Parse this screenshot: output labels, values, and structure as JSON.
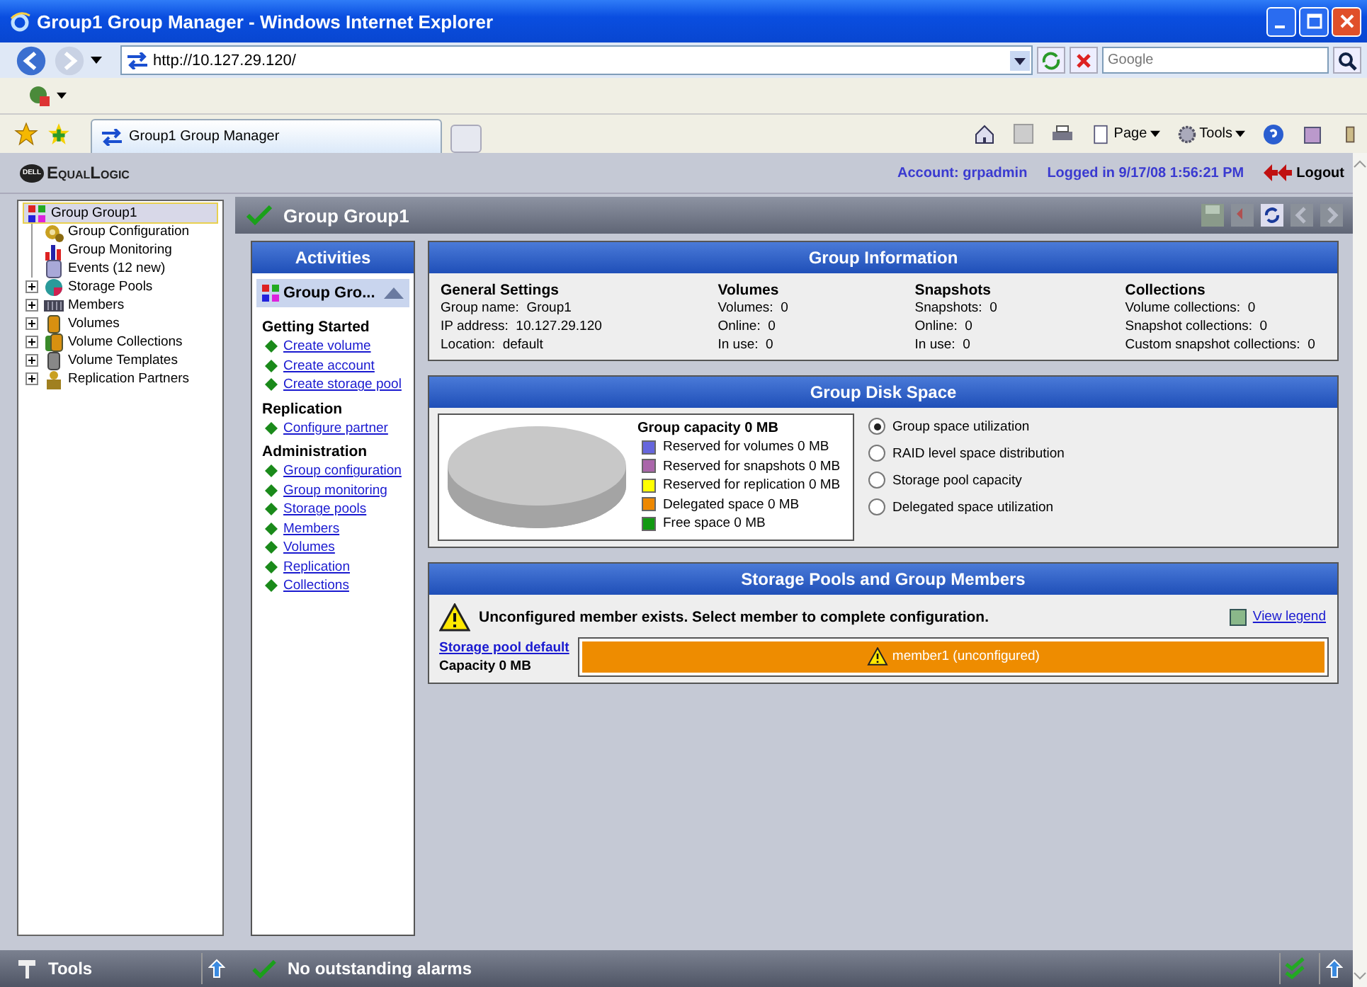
{
  "window": {
    "title": "Group1 Group Manager - Windows Internet Explorer"
  },
  "browser": {
    "address": "http://10.127.29.120/",
    "search_placeholder": "Google",
    "tab": "Group1 Group Manager",
    "commands": [
      "Page",
      "Tools"
    ]
  },
  "app_header": {
    "logo_badge": "DELL",
    "logo": "EqualLogic",
    "account": "Account: grpadmin",
    "logged_in": "Logged in 9/17/08 1:56:21 PM",
    "logout": "Logout"
  },
  "tree": [
    {
      "label": "Group Group1",
      "kind": "group",
      "selected": true,
      "children": [
        {
          "label": "Group Configuration",
          "kind": "config",
          "selected": false
        },
        {
          "label": "Group Monitoring",
          "kind": "monitor",
          "selected": false
        },
        {
          "label": "Events (12 new)",
          "kind": "events",
          "selected": false
        },
        {
          "label": "Storage Pools",
          "kind": "pools",
          "selected": false,
          "expanded": false
        },
        {
          "label": "Members",
          "kind": "members",
          "selected": false,
          "expanded": false
        },
        {
          "label": "Volumes",
          "kind": "volume",
          "selected": false,
          "expanded": false
        },
        {
          "label": "Volume Collections",
          "kind": "collections",
          "selected": false,
          "expanded": false
        },
        {
          "label": "Volume Templates",
          "kind": "template",
          "selected": false,
          "expanded": false
        },
        {
          "label": "Replication Partners",
          "kind": "partners",
          "selected": false,
          "expanded": false
        }
      ]
    }
  ],
  "main_header": {
    "title": "Group Group1"
  },
  "activities": {
    "title": "Activities",
    "selector": "Group Gro...",
    "sections": [
      {
        "title": "Getting Started",
        "links": [
          "Create volume",
          "Create account",
          "Create storage pool"
        ]
      },
      {
        "title": "Replication",
        "links": [
          "Configure partner"
        ]
      },
      {
        "title": "Administration",
        "links": [
          "Group configuration",
          "Group monitoring",
          "Storage pools",
          "Members",
          "Volumes",
          "Replication",
          "Collections"
        ]
      }
    ]
  },
  "group_information": {
    "title": "Group Information",
    "columns": [
      {
        "heading": "General Settings",
        "lines": [
          {
            "label": "Group name:",
            "value": "Group1"
          },
          {
            "label": "IP address:",
            "value": "10.127.29.120"
          },
          {
            "label": "Location:",
            "value": "default"
          }
        ]
      },
      {
        "heading": "Volumes",
        "lines": [
          {
            "label": "Volumes:",
            "value": "0"
          },
          {
            "label": "Online:",
            "value": "0"
          },
          {
            "label": "In use:",
            "value": "0"
          }
        ]
      },
      {
        "heading": "Snapshots",
        "lines": [
          {
            "label": "Snapshots:",
            "value": "0"
          },
          {
            "label": "Online:",
            "value": "0"
          },
          {
            "label": "In use:",
            "value": "0"
          }
        ]
      },
      {
        "heading": "Collections",
        "lines": [
          {
            "label": "Volume collections:",
            "value": "0"
          },
          {
            "label": "Snapshot collections:",
            "value": "0"
          },
          {
            "label": "Custom snapshot collections:",
            "value": "0"
          }
        ]
      }
    ]
  },
  "disk_space": {
    "title": "Group Disk Space",
    "legend_title": "Group capacity 0 MB",
    "legend": [
      {
        "label": "Reserved for volumes 0 MB",
        "color": "#6666dd"
      },
      {
        "label": "Reserved for snapshots 0 MB",
        "color": "#aa66aa"
      },
      {
        "label": "Reserved for replication 0 MB",
        "color": "#ffff00"
      },
      {
        "label": "Delegated space 0 MB",
        "color": "#ee8800"
      },
      {
        "label": "Free space 0 MB",
        "color": "#119911"
      }
    ],
    "options": [
      {
        "label": "Group space utilization",
        "selected": true
      },
      {
        "label": "RAID level space distribution",
        "selected": false
      },
      {
        "label": "Storage pool capacity",
        "selected": false
      },
      {
        "label": "Delegated space utilization",
        "selected": false
      }
    ]
  },
  "storage_pools": {
    "title": "Storage Pools and Group Members",
    "warning": "Unconfigured member exists. Select member to complete configuration.",
    "legend_link": "View legend",
    "pool": {
      "name": "Storage pool default",
      "capacity": "Capacity 0 MB"
    },
    "members": [
      {
        "label": "member1 (unconfigured)"
      }
    ]
  },
  "footer": {
    "tools": "Tools",
    "status": "No outstanding alarms"
  }
}
